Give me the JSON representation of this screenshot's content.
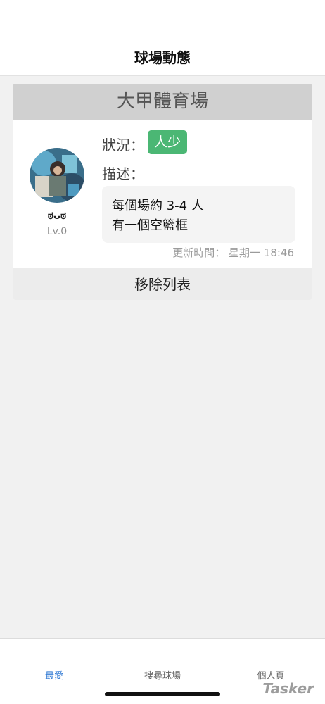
{
  "header": {
    "title": "球場動態"
  },
  "card": {
    "court_name": "大甲體育場",
    "user": {
      "name": "ಠᴗಠ",
      "level": "Lv.0"
    },
    "status_label": "狀況：",
    "status_value": "人少",
    "status_color": "#4bb774",
    "description_label": "描述：",
    "description_lines": [
      "每個場約 3-4 人",
      "有一個空籃框"
    ],
    "update_time": "更新時間： 星期一 18:46",
    "remove_button": "移除列表"
  },
  "tabbar": {
    "items": [
      {
        "label": "最愛",
        "active": true
      },
      {
        "label": "搜尋球場",
        "active": false
      },
      {
        "label": "個人頁",
        "active": false
      }
    ],
    "active_color": "#3a7fd5"
  },
  "watermark": "Tasker"
}
